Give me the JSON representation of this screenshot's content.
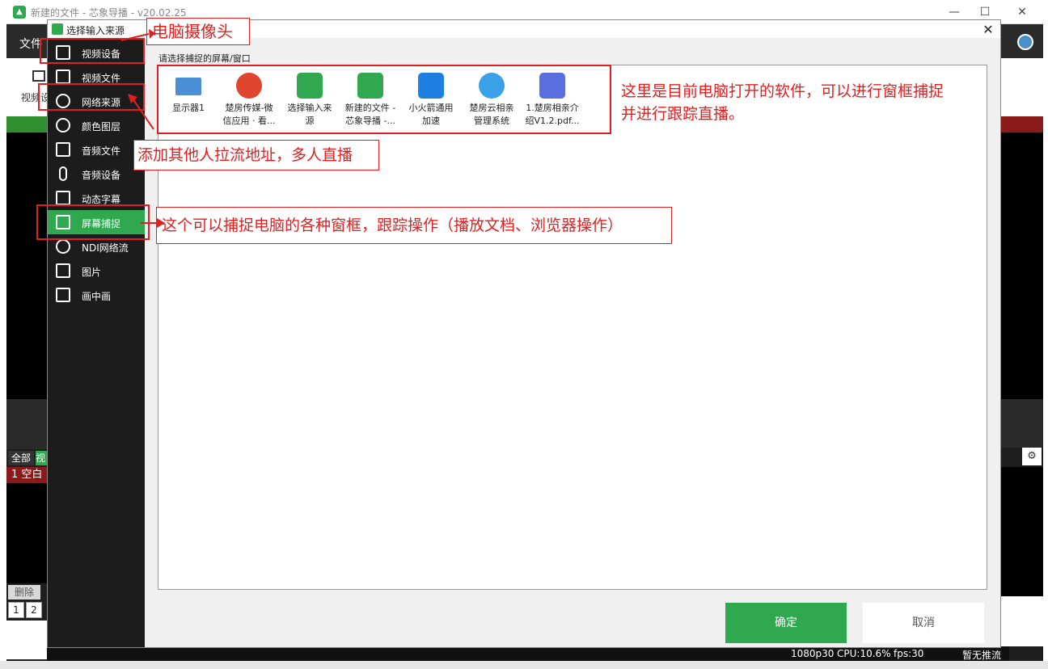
{
  "app": {
    "title": "新建的文件 - 芯象导播 - v20.02.25",
    "menu_file": "文件",
    "toolbar_label": "视频设",
    "tab_all": "全部",
    "tab_video": "视",
    "item_blank": "1 空白",
    "delete": "删除",
    "page1": "1",
    "page2": "2",
    "win_min": "—",
    "win_max": "☐",
    "win_close": "✕",
    "settings_icon": "⚙"
  },
  "status": {
    "resolution": "1080p30",
    "cpu": "CPU:10.6%",
    "fps": "fps:30",
    "push": "暂无推流"
  },
  "dialog": {
    "title": "选择输入来源",
    "close": "✕",
    "prompt": "请选择捕捉的屏幕/窗口",
    "ok": "确定",
    "cancel": "取消"
  },
  "sidebar": {
    "items": [
      {
        "label": "视频设备",
        "icon": "video-camera-icon"
      },
      {
        "label": "视频文件",
        "icon": "video-file-icon"
      },
      {
        "label": "网络来源",
        "icon": "network-icon"
      },
      {
        "label": "颜色图层",
        "icon": "palette-icon"
      },
      {
        "label": "音频文件",
        "icon": "audio-file-icon"
      },
      {
        "label": "音频设备",
        "icon": "microphone-icon"
      },
      {
        "label": "动态字幕",
        "icon": "text-icon"
      },
      {
        "label": "屏幕捕捉",
        "icon": "monitor-icon"
      },
      {
        "label": "NDI网络流",
        "icon": "ndi-icon"
      },
      {
        "label": "图片",
        "icon": "image-icon"
      },
      {
        "label": "画中画",
        "icon": "pip-icon"
      }
    ],
    "active_index": 7
  },
  "windows": [
    {
      "label": "显示器1",
      "icon": "monitor-icon"
    },
    {
      "label": "楚房传媒-微\n信应用 · 看...",
      "icon": "chrome-icon"
    },
    {
      "label": "选择输入来\n源",
      "icon": "xinxiang-icon"
    },
    {
      "label": "新建的文件 -\n芯象导播 -...",
      "icon": "xinxiang-icon"
    },
    {
      "label": "小火箭通用\n加速",
      "icon": "rocket-shield-icon"
    },
    {
      "label": "楚房云相亲\n管理系统",
      "icon": "cloud-browser-icon"
    },
    {
      "label": "1.楚房相亲介\n绍V1.2.pdf...",
      "icon": "pdf-reader-icon"
    }
  ],
  "annotations": {
    "camera": "电脑摄像头",
    "network": "添加其他人拉流地址，多人直播",
    "screen": "这个可以捕捉电脑的各种窗框，跟踪操作（播放文档、浏览器操作）",
    "software_line1": "这里是目前电脑打开的软件，可以进行窗框捕捉",
    "software_line2": "并进行跟踪直播。"
  },
  "colors": {
    "accent_green": "#2fa84f",
    "annotation_red": "#e02020"
  }
}
